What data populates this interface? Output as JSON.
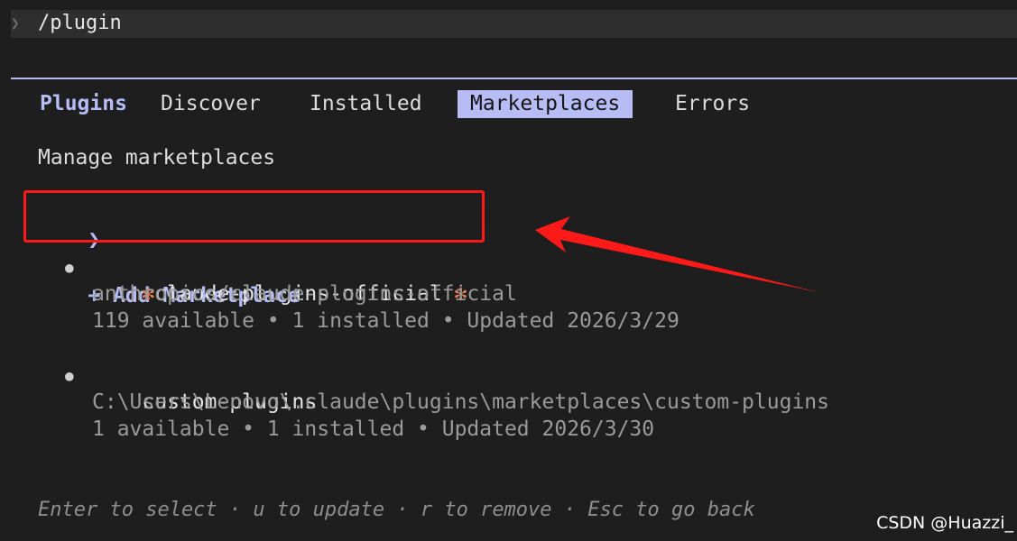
{
  "prompt": {
    "caret": "❯",
    "command": "/plugin"
  },
  "tabs": {
    "header": "Plugins",
    "items": [
      {
        "label": "Discover"
      },
      {
        "label": "Installed"
      },
      {
        "label": "Marketplaces",
        "active": true
      },
      {
        "label": "Errors"
      }
    ]
  },
  "subtitle": "Manage marketplaces",
  "add_marketplace": {
    "caret": "❯",
    "label": "+ Add Marketplace"
  },
  "marketplaces": [
    {
      "bullet": "●",
      "star_left": "✻",
      "name": "claude-plugins-official",
      "star_right": "✻",
      "source": "anthropics/claude-plugins-official",
      "stats": "119 available • 1 installed • Updated 2026/3/29"
    },
    {
      "bullet": "●",
      "name": "custom-plugins",
      "source": "C:\\Users\\Lenovo\\.claude\\plugins\\marketplaces\\custom-plugins",
      "stats": "1 available • 1 installed • Updated 2026/3/30"
    }
  ],
  "footer": "Enter to select · u to update · r to remove · Esc to go back",
  "watermark": "CSDN @Huazzi_",
  "colors": {
    "accent": "#b7bcf5",
    "annotation": "#ff1a1a",
    "star": "#e0805a",
    "background": "#1e1e1e"
  }
}
